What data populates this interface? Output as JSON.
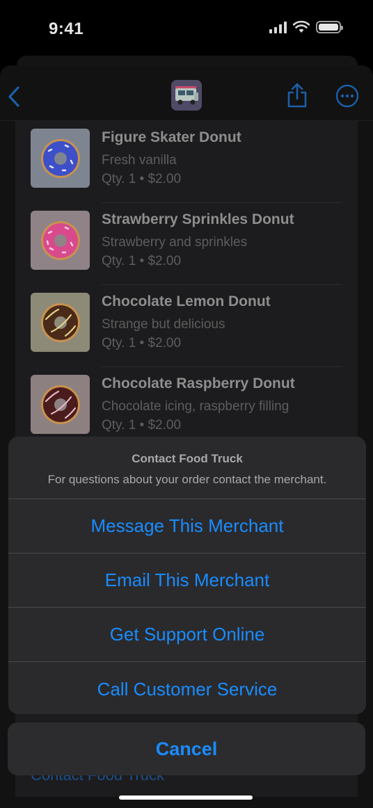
{
  "status_bar": {
    "time": "9:41"
  },
  "order_items": [
    {
      "name": "Figure Skater Donut",
      "description": "Fresh vanilla",
      "qty_price": "Qty. 1 • $2.00",
      "icing_color": "#3d4fc9",
      "sprinkle_color": "#e8e8ff"
    },
    {
      "name": "Strawberry Sprinkles Donut",
      "description": "Strawberry and sprinkles",
      "qty_price": "Qty. 1 • $2.00",
      "icing_color": "#d94a8c",
      "sprinkle_color": "#ffd0e6"
    },
    {
      "name": "Chocolate Lemon Donut",
      "description": "Strange but delicious",
      "qty_price": "Qty. 1 • $2.00",
      "icing_color": "#4a2a18",
      "sprinkle_color": "#e6d38a"
    },
    {
      "name": "Chocolate Raspberry Donut",
      "description": "Chocolate icing, raspberry filling",
      "qty_price": "Qty. 1 • $2.00",
      "icing_color": "#4a1c1c",
      "sprinkle_color": "#e6b8c8"
    }
  ],
  "background_link": "Contact Food Truck",
  "action_sheet": {
    "title": "Contact Food Truck",
    "message": "For questions about your order contact the merchant.",
    "actions": [
      "Message This Merchant",
      "Email This Merchant",
      "Get Support Online",
      "Call Customer Service"
    ],
    "cancel": "Cancel"
  },
  "colors": {
    "accent": "#1a8cff",
    "sheet_bg": "#2a2a2c"
  }
}
